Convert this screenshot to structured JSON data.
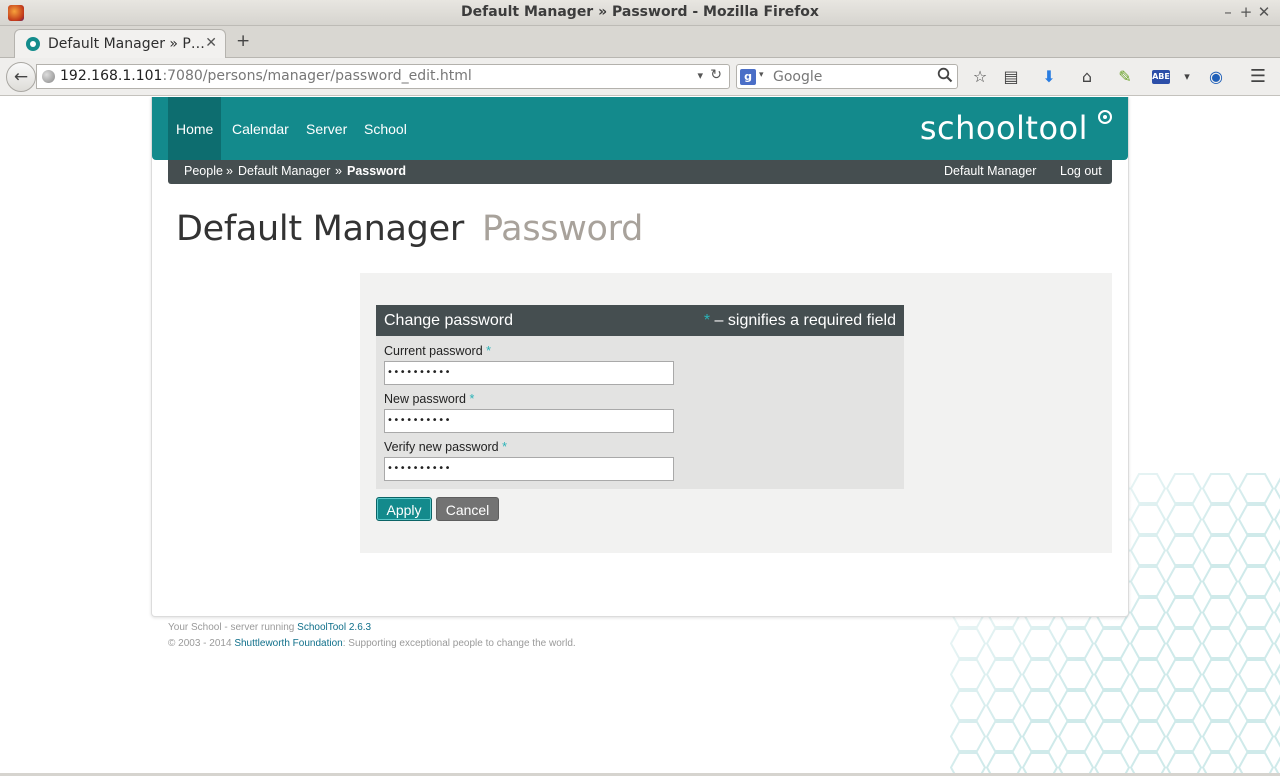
{
  "window": {
    "title": "Default Manager » Password - Mozilla Firefox",
    "minimize": "–",
    "maximize": "+",
    "close": "✕"
  },
  "tabs": [
    {
      "label": "Default Manager » P…",
      "close": "✕"
    }
  ],
  "new_tab": "+",
  "nav": {
    "back": "←",
    "url_host": "192.168.1.101",
    "url_rest": ":7080/persons/manager/password_edit.html",
    "dropdown": "▾",
    "reload": "↻",
    "search_engine": "g",
    "search_dropdown": "▾",
    "search_placeholder": "Google",
    "search_icon": "🔍",
    "toolbar_icons": [
      "☆",
      "▤",
      "⬇",
      "⌂",
      "✎",
      "ABE",
      "▾",
      "◉",
      "☰"
    ]
  },
  "site": {
    "nav_items": [
      "Home",
      "Calendar",
      "Server",
      "School"
    ],
    "active_nav": "Home",
    "brand": "schooltool",
    "breadcrumb": [
      "People",
      "Default Manager",
      "Password"
    ],
    "breadcrumb_sep": "»",
    "user_name": "Default Manager",
    "logout": "Log out"
  },
  "page": {
    "title": "Default Manager",
    "subtitle": "Password"
  },
  "form": {
    "legend": "Change password",
    "required_marker": "*",
    "required_note": " – signifies a required field",
    "fields": [
      {
        "label": "Current password",
        "value": "••••••••••"
      },
      {
        "label": "New password",
        "value": "••••••••••"
      },
      {
        "label": "Verify new password",
        "value": "••••••••••"
      }
    ],
    "apply": "Apply",
    "cancel": "Cancel"
  },
  "footer": {
    "line1_text": "Your School - server running ",
    "line1_link": "SchoolTool 2.6.3",
    "line2_text": "© 2003 - 2014 ",
    "line2_link": "Shuttleworth Foundation",
    "line2_tail": ": Supporting exceptional people to change the world."
  },
  "colors": {
    "brand_teal": "#138a8c",
    "dark_bar": "#454e50",
    "required_star": "#2bb3b8"
  }
}
